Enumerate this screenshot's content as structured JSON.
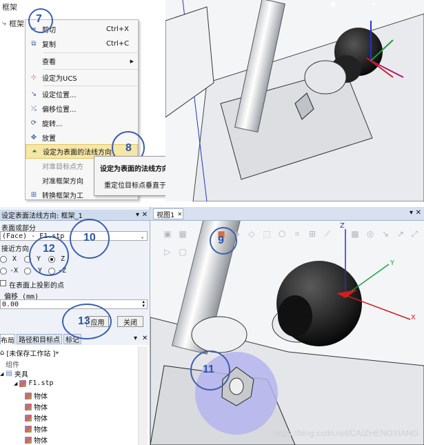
{
  "top_left": {
    "tree_label": "框架",
    "tree_item_label": "框架"
  },
  "context_menu": {
    "items": [
      {
        "label": "剪切",
        "shortcut": "Ctrl+X",
        "icon": "scissors-icon"
      },
      {
        "label": "复制",
        "shortcut": "Ctrl+C",
        "icon": "copy-icon"
      },
      {
        "label": "查看",
        "shortcut": "",
        "icon": "",
        "submenu": true
      },
      {
        "label": "设定为UCS",
        "shortcut": "",
        "icon": "ucs-icon"
      },
      {
        "label": "设定位置...",
        "shortcut": "",
        "icon": "set-position-icon"
      },
      {
        "label": "偏移位置...",
        "shortcut": "",
        "icon": "offset-position-icon"
      },
      {
        "label": "旋转...",
        "shortcut": "",
        "icon": "rotate-icon"
      },
      {
        "label": "放置",
        "shortcut": "",
        "icon": "place-icon"
      },
      {
        "label": "设定为表面的法线方向",
        "shortcut": "",
        "icon": "surface-normal-icon",
        "highlighted": true
      },
      {
        "label": "对准目标点方",
        "shortcut": "",
        "icon": "",
        "disabled": true
      },
      {
        "label": "对准框架方向",
        "shortcut": "",
        "icon": ""
      },
      {
        "label": "转换框架为工",
        "shortcut": "",
        "icon": "convert-frame-icon"
      }
    ],
    "submenu_arrow": "▶"
  },
  "tooltip": {
    "title": "设定为表面的法线方向",
    "description": "重定位目标点垂直于表面。"
  },
  "steps": {
    "s7": "7",
    "s8": "8",
    "s9": "9",
    "s10": "10",
    "s11": "11",
    "s12": "12",
    "s13": "13"
  },
  "surface_panel": {
    "title": "设定表面法线方向: 框架_1",
    "pin": "▾",
    "close": "✕",
    "surface_label": "表面或部分",
    "surface_value": "(Face) - F1.stp",
    "approach_label": "接近方向",
    "radios": [
      {
        "label": "X",
        "selected": false
      },
      {
        "label": "Y",
        "selected": false
      },
      {
        "label": "Z",
        "selected": true
      },
      {
        "label": "-X",
        "selected": false
      },
      {
        "label": "-Y",
        "selected": false
      },
      {
        "label": "-Z",
        "selected": false
      }
    ],
    "project_label": "在表面上投影的点",
    "offset_label": "偏移 (mm)",
    "offset_value": "0.00",
    "apply": "应用",
    "close_button": "关闭"
  },
  "layout_panel": {
    "tabs": [
      "布局",
      "路径和目标点",
      "标记"
    ],
    "pin": "▾",
    "close": "✕",
    "station": "[未保存工作站 ]*",
    "group": "组件",
    "fixture": "夹具",
    "file": "F1.stp",
    "bodies": [
      "物体",
      "物体",
      "物体",
      "物体",
      "物体"
    ]
  },
  "view": {
    "tab_label": "视图1",
    "tab_close": "✕",
    "pin": "▾",
    "close": "✕",
    "axis_x": "X",
    "axis_y": "Y",
    "axis_z": "Z"
  },
  "watermark": "https://blog.csdn.net/CAIZHENGXIANG",
  "colors": {
    "highlight": "#f6e7a6",
    "annotation": "#3b5fae",
    "axis_x": "#d21d1d",
    "axis_y": "#1e9e3a",
    "axis_z": "#2233cc"
  }
}
